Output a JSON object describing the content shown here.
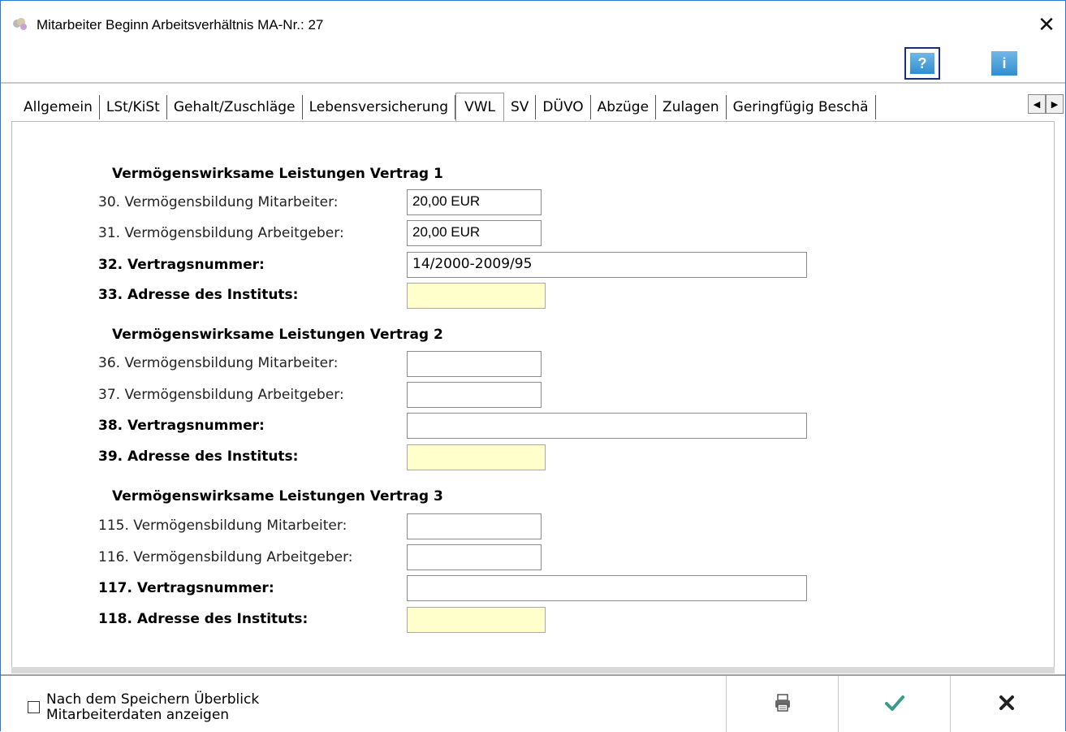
{
  "window": {
    "title": "Mitarbeiter Beginn Arbeitsverhältnis MA-Nr.: 27",
    "close_glyph": "✕"
  },
  "toolbar": {
    "help_label": "?",
    "info_label": "i"
  },
  "tabs": [
    {
      "label": "Allgemein",
      "active": false
    },
    {
      "label": "LSt/KiSt",
      "active": false
    },
    {
      "label": "Gehalt/Zuschläge",
      "active": false
    },
    {
      "label": "Lebensversicherung",
      "active": false
    },
    {
      "label": "VWL",
      "active": true
    },
    {
      "label": "SV",
      "active": false
    },
    {
      "label": "DÜVO",
      "active": false
    },
    {
      "label": "Abzüge",
      "active": false
    },
    {
      "label": "Zulagen",
      "active": false
    },
    {
      "label": "Geringfügig Beschä",
      "active": false
    }
  ],
  "tab_scroll": {
    "left": "◀",
    "right": "▶"
  },
  "contracts": [
    {
      "title": "Vermögenswirksame Leistungen Vertrag 1",
      "employee_label": "30. Vermögensbildung Mitarbeiter:",
      "employee_value": "20,00 EUR",
      "employer_label": "31. Vermögensbildung Arbeitgeber:",
      "employer_value": "20,00 EUR",
      "contract_no_label": "32. Vertragsnummer:",
      "contract_no_value": "14/2000-2009/95",
      "address_label": "33. Adresse des Instituts:",
      "address_value": ""
    },
    {
      "title": "Vermögenswirksame Leistungen Vertrag 2",
      "employee_label": "36. Vermögensbildung Mitarbeiter:",
      "employee_value": "",
      "employer_label": "37. Vermögensbildung Arbeitgeber:",
      "employer_value": "",
      "contract_no_label": "38. Vertragsnummer:",
      "contract_no_value": "",
      "address_label": "39. Adresse des Instituts:",
      "address_value": ""
    },
    {
      "title": "Vermögenswirksame Leistungen Vertrag 3",
      "employee_label": "115. Vermögensbildung Mitarbeiter:",
      "employee_value": "",
      "employer_label": "116. Vermögensbildung Arbeitgeber:",
      "employer_value": "",
      "contract_no_label": "117. Vertragsnummer:",
      "contract_no_value": "",
      "address_label": "118. Adresse des Instituts:",
      "address_value": ""
    }
  ],
  "footer": {
    "checkbox_label_line1": "Nach dem Speichern Überblick",
    "checkbox_label_line2": "Mitarbeiterdaten anzeigen",
    "checkbox_checked": false,
    "print_icon": "printer-icon",
    "ok_icon": "checkmark-icon",
    "cancel_icon": "x-icon"
  },
  "colors": {
    "accent": "#2b79d7",
    "address_field_bg": "#ffffcc",
    "ok_green": "#3a9b8a"
  }
}
